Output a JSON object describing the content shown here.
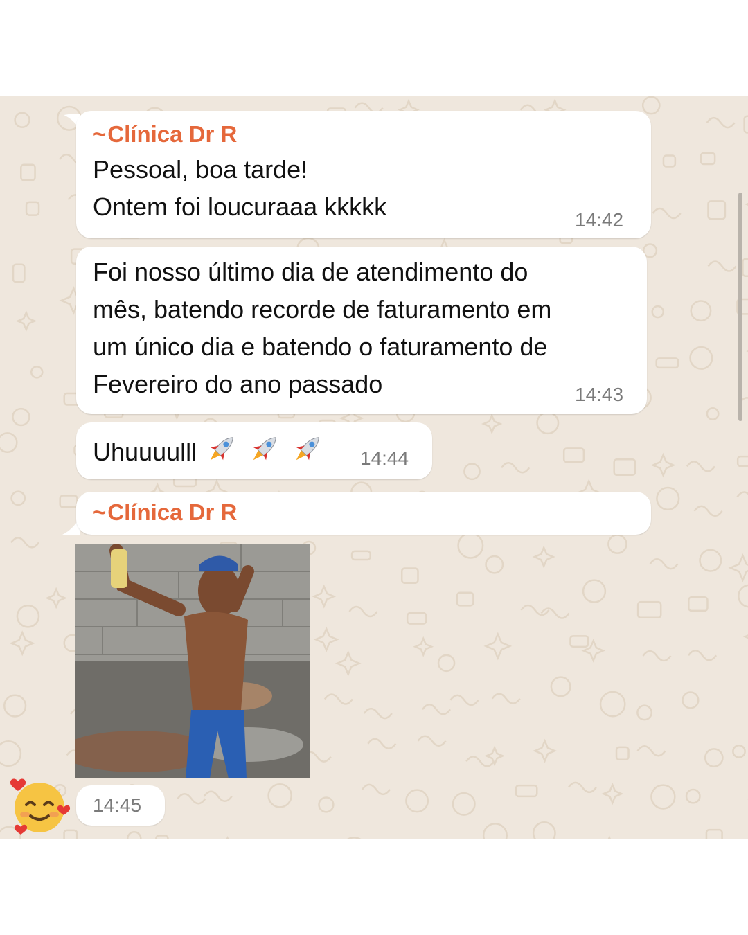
{
  "messages": [
    {
      "sender": "Clínica Dr R",
      "sender_prefix": "~",
      "text": "Pessoal, boa tarde!\nOntem foi loucuraaa kkkkk",
      "time": "14:42"
    },
    {
      "text": "Foi nosso último dia de atendimento do\nmês, batendo recorde de faturamento em\num único dia e batendo o faturamento de\nFevereiro do ano passado",
      "time": "14:43"
    },
    {
      "text": "Uhuuuulll",
      "trailing_icons": [
        "rocket-icon",
        "rocket-icon",
        "rocket-icon"
      ],
      "time": "14:44"
    },
    {
      "sender": "Clínica Dr R",
      "sender_prefix": "~",
      "attachment": "photo",
      "time": "14:45"
    }
  ],
  "avatar": {
    "icon": "smiling-face-with-hearts-icon"
  },
  "colors": {
    "chat_background": "#efe7dd",
    "bubble": "#ffffff",
    "sender_name": "#e5683b",
    "timestamp": "#7a7a7a",
    "text": "#111111"
  }
}
